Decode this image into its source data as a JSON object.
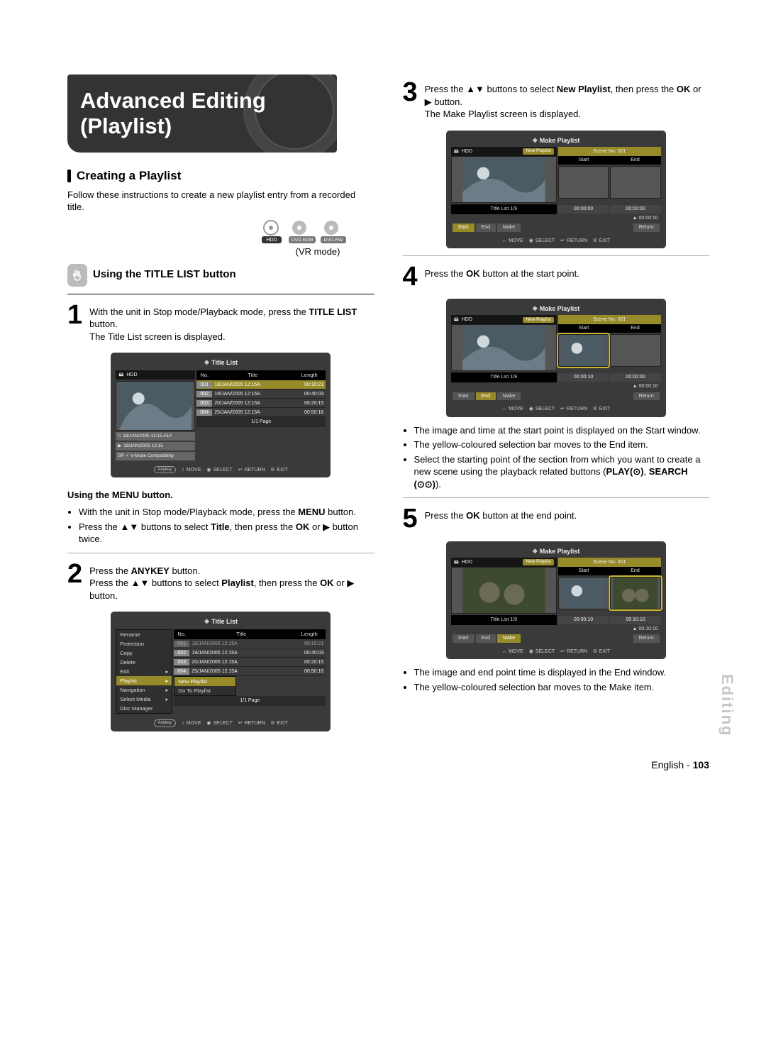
{
  "header": {
    "title_l1": "Advanced Editing",
    "title_l2": "(Playlist)"
  },
  "creating": {
    "heading": "Creating a Playlist",
    "intro": "Follow these instructions to create a new playlist entry from a recorded title.",
    "discs": {
      "hdd": "HDD",
      "ram": "DVD-RAM",
      "rw": "DVD-RW"
    },
    "vrmode": "(VR mode)",
    "using_title_list": "Using the TITLE LIST button"
  },
  "steps": {
    "s1_a": "With the unit in Stop mode/Playback mode, press the ",
    "s1_b": "TITLE LIST",
    "s1_c": " button.",
    "s1_d": "The Title List screen is displayed.",
    "menu_hdr": "Using the MENU button.",
    "menu_b1a": "With the unit in Stop mode/Playback mode, press the ",
    "menu_b1b": "MENU",
    "menu_b1c": " button.",
    "menu_b2a": "Press the ▲▼ buttons to select ",
    "menu_b2b": "Title",
    "menu_b2c": ", then press the ",
    "menu_b2d": "OK",
    "menu_b2e": " or ▶ button twice.",
    "s2_a": "Press the ",
    "s2_b": "ANYKEY",
    "s2_c": " button.",
    "s2_d": "Press the ▲▼ buttons to select ",
    "s2_e": "Playlist",
    "s2_f": ", then press the ",
    "s2_g": "OK",
    "s2_h": " or ▶ button.",
    "s3_a": "Press the ▲▼ buttons to select ",
    "s3_b": "New Playlist",
    "s3_c": ", then press the ",
    "s3_d": "OK",
    "s3_e": " or ▶ button.",
    "s3_f": "The Make Playlist screen is displayed.",
    "s4_a": "Press the ",
    "s4_b": "OK",
    "s4_c": " button at the start point.",
    "s4_bul1": "The image and time at the start point is displayed on the Start window.",
    "s4_bul2": "The yellow-coloured selection bar moves to the End item.",
    "s4_bul3a": "Select the starting point of the section from which you want to create a new scene using the playback related  buttons (",
    "s4_bul3b": "PLAY(⊙)",
    "s4_bul3c": ", ",
    "s4_bul3d": "SEARCH (⊙⊙)",
    "s4_bul3e": ").",
    "s5_a": "Press the ",
    "s5_b": "OK",
    "s5_c": " button at the end point.",
    "s5_bul1": "The image and end point time is displayed in the End window.",
    "s5_bul2": "The yellow-coloured selection bar moves to the Make item."
  },
  "shots": {
    "title_list": {
      "caption": "Title List",
      "hdd": "HDD",
      "cols": {
        "no": "No.",
        "title": "Title",
        "len": "Length"
      },
      "rows": [
        {
          "no": "001",
          "title": "18/JAN/2005 12:15A",
          "len": "00:10:21"
        },
        {
          "no": "002",
          "title": "19/JAN/2005 12:15A",
          "len": "00:40:03"
        },
        {
          "no": "003",
          "title": "20/JAN/2005 12:15A",
          "len": "00:20:15"
        },
        {
          "no": "004",
          "title": "25/JAN/2005 12:15A",
          "len": "00:50:16"
        }
      ],
      "info1": "18/JAN/2005 12:15 A10",
      "info2": "18/JAN/2005 12:15",
      "compat": "SP ✓ V-Mode Compatibility",
      "page": "1/1 Page",
      "anykey": "Anykey",
      "move": "MOVE",
      "select": "SELECT",
      "return": "RETURN",
      "exit": "EXIT"
    },
    "menu": {
      "items": [
        "Rename",
        "Protection",
        "Copy",
        "Delete",
        "Edit",
        "Playlist",
        "Navigation",
        "Select Media",
        "Disc Manager"
      ],
      "hl": 5,
      "sub": [
        "New Playlist",
        "Go To Playlist"
      ],
      "sub_hl": 0
    },
    "make": {
      "caption": "Make Playlist",
      "hdd": "HDD",
      "newpl": "New Playlist",
      "scene": "Scene No. 001",
      "start_h": "Start",
      "end_h": "End",
      "tl": "Title List 1/9",
      "btn_start": "Start",
      "btn_end": "End",
      "btn_make": "Make",
      "btn_return": "Return"
    },
    "m3": {
      "t_start": "00:00:00",
      "t_end": "00:00:00",
      "total": "00:00:10"
    },
    "m4": {
      "t_start": "00:00:10",
      "t_end": "00:00:00",
      "total": "00:00:10"
    },
    "m5": {
      "t_start": "00:00:10",
      "t_end": "00:10:10",
      "total": "00:10:10"
    }
  },
  "sidetab": "Editing",
  "footer": {
    "lang": "English - ",
    "page": "103"
  }
}
